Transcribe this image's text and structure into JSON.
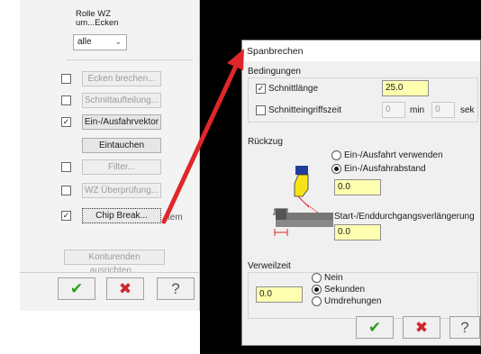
{
  "left_panel": {
    "rolle_label": "Rolle WZ\num...Ecken",
    "rolle_value": "alle",
    "ecken_brechen": "Ecken brechen...",
    "schnittaufteilung": "Schnittaufteilung...",
    "ein_ausfahrvektor": "Ein-/Ausfahrvektor",
    "eintauchen": "Eintauchen",
    "filter": "Filter...",
    "wz_ueberpruefung": "WZ Überprüfung...",
    "chip_break": "Chip Break...",
    "chip_suffix": "tem",
    "konturenden": "Konturenden ausrichten..."
  },
  "dialog": {
    "title": "Spanbrechen",
    "bedingungen": {
      "title": "Bedingungen",
      "schnittlaenge_label": "Schnittlänge",
      "schnittlaenge_value": "25.0",
      "schnitteingriffszeit_label": "Schnitteingriffszeit",
      "min_value": "0",
      "min_unit": "min",
      "sek_value": "0",
      "sek_unit": "sek"
    },
    "rueckzug": {
      "title": "Rückzug",
      "option1": "Ein-/Ausfahrt verwenden",
      "option2": "Ein-/Ausfahrabstand",
      "abstand_value": "0.0",
      "verlaengerung_label": "Start-/Enddurchgangsverlängerung",
      "verlaengerung_value": "0.0"
    },
    "verweilzeit": {
      "title": "Verweilzeit",
      "value": "0.0",
      "option_nein": "Nein",
      "option_sekunden": "Sekunden",
      "option_umdrehungen": "Umdrehungen"
    }
  },
  "colors": {
    "ok_green": "#2e9e1e",
    "cancel_red": "#d0252e",
    "arrow_red": "#e0262a",
    "input_yellow": "#ffffb0"
  },
  "icons": {
    "ok": "check-icon",
    "cancel": "x-icon",
    "help": "question-icon"
  }
}
